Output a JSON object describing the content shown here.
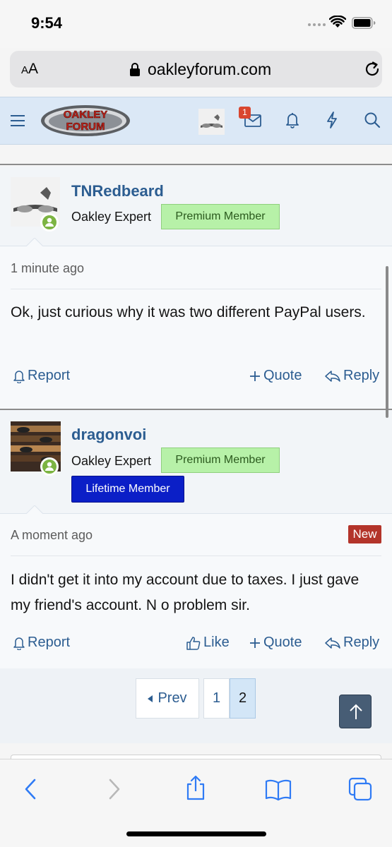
{
  "status_bar": {
    "time": "9:54"
  },
  "browser": {
    "aa_small": "A",
    "aa_large": "A",
    "url": "oakleyforum.com"
  },
  "header": {
    "logo_line1": "OAKLEY",
    "logo_line2": "FORUM",
    "inbox_badge": "1"
  },
  "posts": [
    {
      "username": "TNRedbeard",
      "user_title": "Oakley Expert",
      "badges": [
        "Premium Member"
      ],
      "time": "1 minute ago",
      "body": "Ok, just curious why it was two different PayPal users.",
      "actions": {
        "report": "Report",
        "quote": "Quote",
        "reply": "Reply"
      }
    },
    {
      "username": "dragonvoi",
      "user_title": "Oakley Expert",
      "badges": [
        "Premium Member",
        "Lifetime Member"
      ],
      "time": "A moment ago",
      "new_label": "New",
      "body": "I didn't get it into my account due to taxes. I just gave my friend's account. N o problem sir.",
      "actions": {
        "report": "Report",
        "like": "Like",
        "quote": "Quote",
        "reply": "Reply"
      }
    }
  ],
  "pagination": {
    "prev": "Prev",
    "pages": [
      "1",
      "2"
    ],
    "current": "2"
  },
  "colors": {
    "link": "#2c5d91",
    "header_bg": "#dbe8f6",
    "premium": "#b7f1a8",
    "lifetime": "#0b1fc7",
    "new": "#b3342a",
    "online": "#7cb442"
  }
}
